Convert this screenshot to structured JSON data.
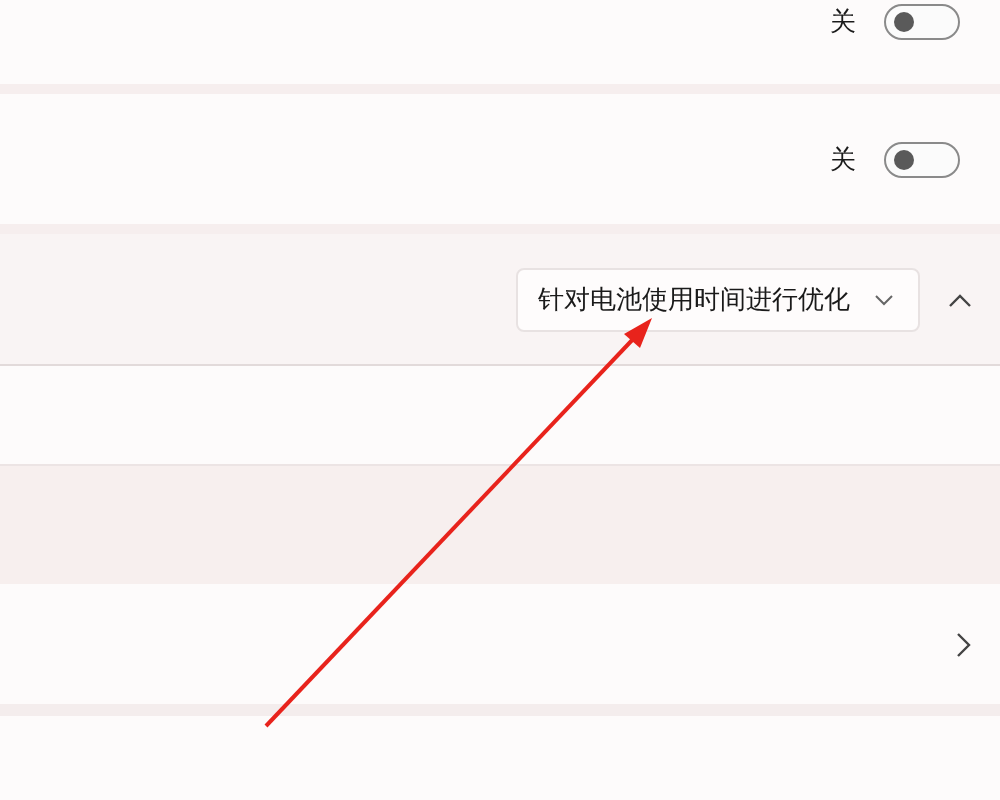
{
  "rows": [
    {
      "kind": "toggle",
      "state_label": "关",
      "on": false
    },
    {
      "kind": "toggle",
      "state_label": "关",
      "on": false
    },
    {
      "kind": "dropdown",
      "value": "针对电池使用时间进行优化",
      "expanded": true
    },
    {
      "kind": "subitem"
    },
    {
      "kind": "subitem_shaded"
    },
    {
      "kind": "link"
    }
  ],
  "annotation": {
    "kind": "arrow"
  }
}
